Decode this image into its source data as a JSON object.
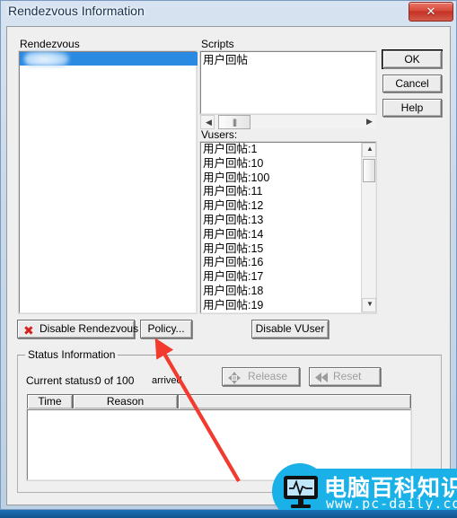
{
  "window": {
    "title": "Rendezvous Information",
    "close_label": "✕"
  },
  "rendezvous": {
    "group_label": "Rendezvous",
    "items": [
      {
        "label": "",
        "redacted": true,
        "selected": true
      }
    ]
  },
  "scripts": {
    "label": "Scripts",
    "items": [
      "用户回帖"
    ],
    "hscroll": {
      "left_arrow": "◀",
      "right_arrow": "▶",
      "thumb_glyph": "|||"
    }
  },
  "vusers": {
    "label": "Vusers:",
    "items": [
      "用户回帖:1",
      "用户回帖:10",
      "用户回帖:100",
      "用户回帖:11",
      "用户回帖:12",
      "用户回帖:13",
      "用户回帖:14",
      "用户回帖:15",
      "用户回帖:16",
      "用户回帖:17",
      "用户回帖:18",
      "用户回帖:19"
    ],
    "vscroll": {
      "up_arrow": "▲",
      "down_arrow": "▼"
    }
  },
  "dialog_buttons": {
    "ok": "OK",
    "cancel": "Cancel",
    "help": "Help"
  },
  "action_buttons": {
    "disable_rendezvous": "Disable Rendezvous",
    "disable_rendezvous_icon": "✖",
    "policy": "Policy...",
    "disable_vuser": "Disable VUser"
  },
  "status": {
    "group_label": "Status Information",
    "current_status_label": "Current status:",
    "current_status_value": "0 of 100",
    "arrived_label": "arrived",
    "release_button": "Release",
    "reset_button": "Reset",
    "table": {
      "columns": [
        "Time",
        "Reason",
        ""
      ],
      "rows": []
    }
  },
  "annotation": {
    "arrow_color": "#f23a2e",
    "points_to": "policy-button"
  },
  "watermark": {
    "text_cn": "电脑百科知识",
    "url": "www.pc-daily.com",
    "color": "#1ab0e8"
  },
  "colors": {
    "selection": "#2a8ae2",
    "dialog_bg": "#efefef",
    "title_text": "#16314f",
    "close_red": "#c33124"
  }
}
